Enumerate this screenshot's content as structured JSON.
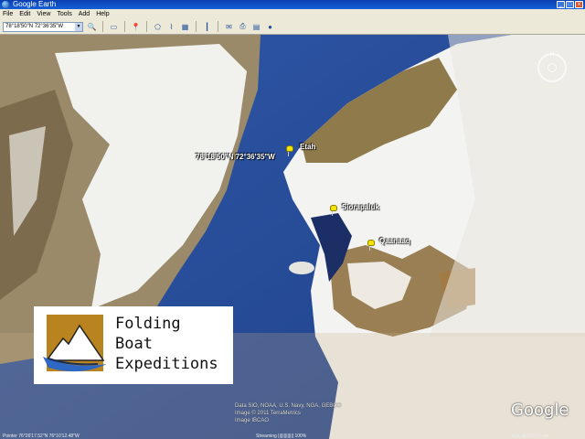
{
  "window": {
    "title": "Google Earth",
    "controls": [
      "_",
      "□",
      "x"
    ]
  },
  "menu": [
    "File",
    "Edit",
    "View",
    "Tools",
    "Add",
    "Help"
  ],
  "toolbar": {
    "coord_value": "78°18'50\"N 72°36'35\"W"
  },
  "map": {
    "coord_label": "78°18'50\"N 72°36'35\"W",
    "places": [
      "Etah",
      "Siorapaluk",
      "Qaanaaq"
    ],
    "compass_label": "N"
  },
  "attribution": {
    "line1": "Data SIO, NOAA, U.S. Navy, NGA, GEBCO",
    "line2": "Image © 2011 TerraMetrics",
    "line3": "Image IBCAO",
    "logo": "Google"
  },
  "status": {
    "left": "Pointer 76°26'17.52\"N 76°10'12.48\"W",
    "mid": "Streaming ||||||||||||| 100%",
    "right": "Eye alt 513.16 km"
  },
  "logo_card": {
    "line1": "Folding",
    "line2": "Boat",
    "line3": "Expeditions"
  },
  "colors": {
    "ocean": "#2a4f9a",
    "ice": "#f2f2f0",
    "rock": "#8a6a3a",
    "pin": "#f4e400",
    "card_brown": "#b98420",
    "kayak_blue": "#2f67c5"
  }
}
